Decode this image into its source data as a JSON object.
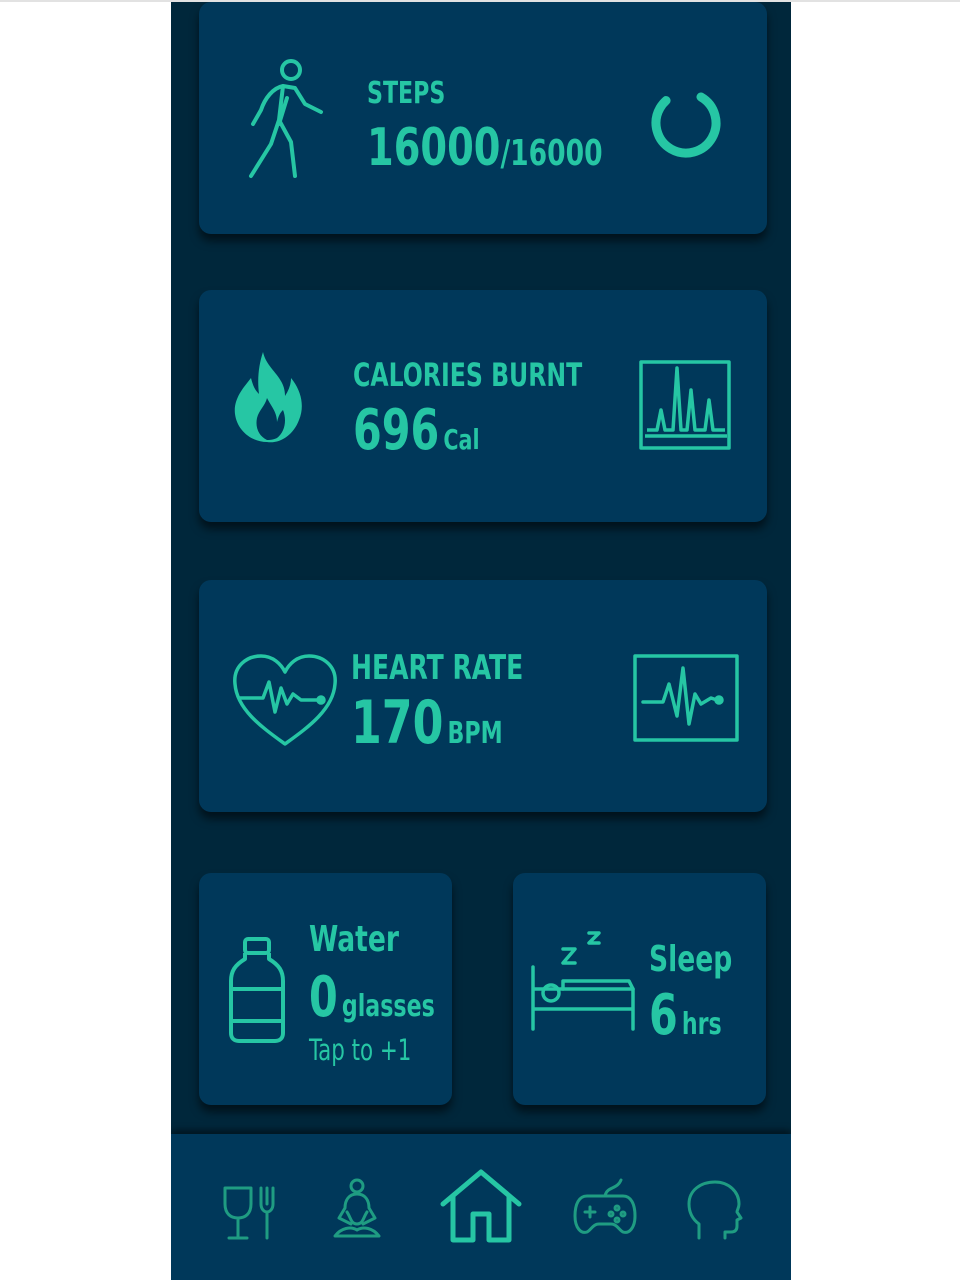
{
  "steps": {
    "label": "STEPS",
    "value": "16000",
    "goal": "/16000",
    "progress": 0.8
  },
  "calories": {
    "label": "CALORIES BURNT",
    "value": "696",
    "unit": "Cal"
  },
  "heart": {
    "label": "HEART RATE",
    "value": "170",
    "unit": "BPM"
  },
  "water": {
    "label": "Water",
    "value": "0",
    "unit": "glasses",
    "hint": "Tap to +1"
  },
  "sleep": {
    "label": "Sleep",
    "value": "6",
    "unit": "hrs",
    "zz": "z z"
  },
  "nav": {
    "items": [
      "diet-icon",
      "meditation-icon",
      "home-icon",
      "games-icon",
      "mind-icon"
    ],
    "active": "home-icon"
  },
  "colors": {
    "bg": "#00273b",
    "card": "#00385a",
    "accent": "#26c6a4"
  }
}
